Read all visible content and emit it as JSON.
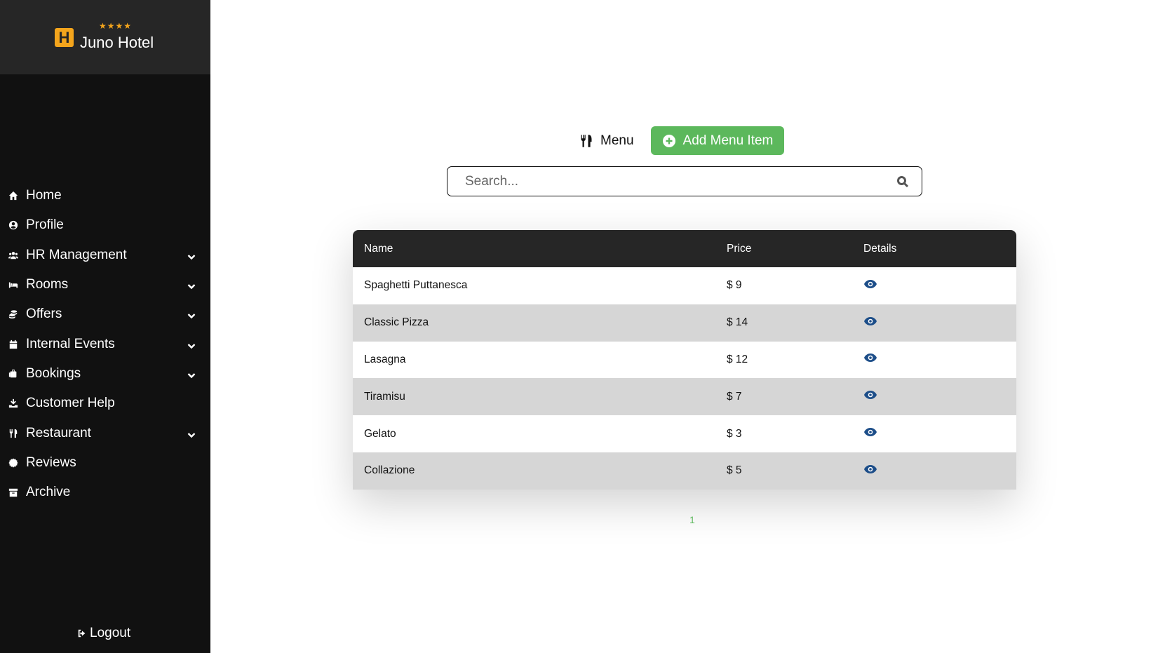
{
  "brand": {
    "stars": "★★★★",
    "logo_letter": "H",
    "name": "Juno Hotel"
  },
  "sidebar": {
    "items": [
      {
        "label": "Home",
        "icon": "home-icon",
        "has_submenu": false
      },
      {
        "label": "Profile",
        "icon": "profile-icon",
        "has_submenu": false
      },
      {
        "label": "HR Management",
        "icon": "users-icon",
        "has_submenu": true
      },
      {
        "label": "Rooms",
        "icon": "bed-icon",
        "has_submenu": true
      },
      {
        "label": "Offers",
        "icon": "coins-icon",
        "has_submenu": true
      },
      {
        "label": "Internal Events",
        "icon": "calendar-icon",
        "has_submenu": true
      },
      {
        "label": "Bookings",
        "icon": "luggage-icon",
        "has_submenu": true
      },
      {
        "label": "Customer Help",
        "icon": "help-icon",
        "has_submenu": false
      },
      {
        "label": "Restaurant",
        "icon": "utensils-icon",
        "has_submenu": true
      },
      {
        "label": "Reviews",
        "icon": "badge-icon",
        "has_submenu": false
      },
      {
        "label": "Archive",
        "icon": "archive-icon",
        "has_submenu": false
      }
    ],
    "logout_label": "Logout"
  },
  "toolbar": {
    "title": "Menu",
    "add_label": "Add Menu Item"
  },
  "search": {
    "placeholder": "Search..."
  },
  "table": {
    "headers": [
      "Name",
      "Price",
      "Details"
    ],
    "rows": [
      {
        "name": "Spaghetti Puttanesca",
        "price": "$ 9"
      },
      {
        "name": "Classic Pizza",
        "price": "$ 14"
      },
      {
        "name": "Lasagna",
        "price": "$ 12"
      },
      {
        "name": "Tiramisu",
        "price": "$ 7"
      },
      {
        "name": "Gelato",
        "price": "$ 3"
      },
      {
        "name": "Collazione",
        "price": "$ 5"
      }
    ]
  },
  "pagination": {
    "current_page": "1"
  },
  "colors": {
    "accent": "#5cb85c",
    "brand": "#f4a51c",
    "eye": "#1d4e89",
    "sidebar": "#111111",
    "table_header": "#262626"
  }
}
